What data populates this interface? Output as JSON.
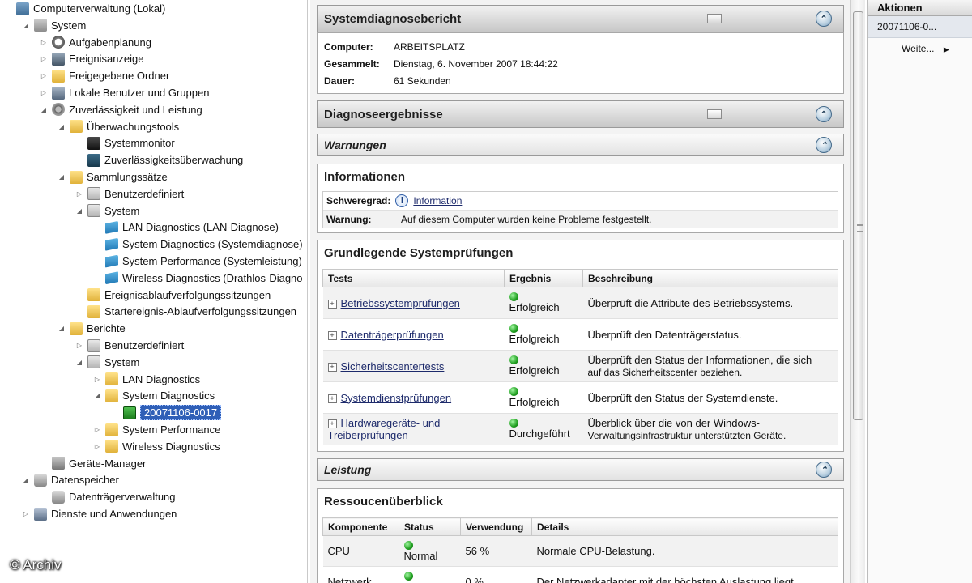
{
  "tree": {
    "nodes": [
      {
        "label": "Computerverwaltung (Lokal)",
        "icon": "computer-icon",
        "level": 0,
        "expander": "none"
      },
      {
        "label": "System",
        "icon": "system-tools-icon",
        "level": 1,
        "expander": "open"
      },
      {
        "label": "Aufgabenplanung",
        "icon": "clock-icon",
        "level": 2,
        "expander": "closed"
      },
      {
        "label": "Ereignisanzeige",
        "icon": "event-viewer-icon",
        "level": 2,
        "expander": "closed"
      },
      {
        "label": "Freigegebene Ordner",
        "icon": "shared-folder-icon",
        "level": 2,
        "expander": "closed"
      },
      {
        "label": "Lokale Benutzer und Gruppen",
        "icon": "users-icon",
        "level": 2,
        "expander": "closed"
      },
      {
        "label": "Zuverlässigkeit und Leistung",
        "icon": "performance-gear-icon",
        "level": 2,
        "expander": "open"
      },
      {
        "label": "Überwachungstools",
        "icon": "folder-icon",
        "level": 3,
        "expander": "open"
      },
      {
        "label": "Systemmonitor",
        "icon": "monitor-icon",
        "level": 4,
        "expander": "none"
      },
      {
        "label": "Zuverlässigkeitsüberwachung",
        "icon": "reliability-monitor-icon",
        "level": 4,
        "expander": "none"
      },
      {
        "label": "Sammlungssätze",
        "icon": "folder-icon",
        "level": 3,
        "expander": "open"
      },
      {
        "label": "Benutzerdefiniert",
        "icon": "report-icon",
        "level": 4,
        "expander": "closed"
      },
      {
        "label": "System",
        "icon": "report-icon",
        "level": 4,
        "expander": "open"
      },
      {
        "label": "LAN Diagnostics (LAN-Diagnose)",
        "icon": "collector-icon",
        "level": 5,
        "expander": "none"
      },
      {
        "label": "System Diagnostics (Systemdiagnose)",
        "icon": "collector-icon",
        "level": 5,
        "expander": "none"
      },
      {
        "label": "System Performance (Systemleistung)",
        "icon": "collector-icon",
        "level": 5,
        "expander": "none"
      },
      {
        "label": "Wireless Diagnostics (Drathlos-Diagno",
        "icon": "collector-icon",
        "level": 5,
        "expander": "none"
      },
      {
        "label": "Ereignisablaufverfolgungssitzungen",
        "icon": "folder-icon",
        "level": 4,
        "expander": "none"
      },
      {
        "label": "Startereignis-Ablaufverfolgungssitzungen",
        "icon": "folder-icon",
        "level": 4,
        "expander": "none"
      },
      {
        "label": "Berichte",
        "icon": "folder-icon",
        "level": 3,
        "expander": "open"
      },
      {
        "label": "Benutzerdefiniert",
        "icon": "report-icon",
        "level": 4,
        "expander": "closed"
      },
      {
        "label": "System",
        "icon": "report-icon",
        "level": 4,
        "expander": "open"
      },
      {
        "label": "LAN Diagnostics",
        "icon": "folder-icon",
        "level": 5,
        "expander": "closed"
      },
      {
        "label": "System Diagnostics",
        "icon": "folder-icon",
        "level": 5,
        "expander": "open"
      },
      {
        "label": "20071106-0017",
        "icon": "green-report-icon",
        "level": 6,
        "expander": "none",
        "selected": true
      },
      {
        "label": "System Performance",
        "icon": "folder-icon",
        "level": 5,
        "expander": "closed"
      },
      {
        "label": "Wireless Diagnostics",
        "icon": "folder-icon",
        "level": 5,
        "expander": "closed"
      },
      {
        "label": "Geräte-Manager",
        "icon": "device-manager-icon",
        "level": 2,
        "expander": "none"
      },
      {
        "label": "Datenspeicher",
        "icon": "storage-icon",
        "level": 1,
        "expander": "open"
      },
      {
        "label": "Datenträgerverwaltung",
        "icon": "disk-icon",
        "level": 2,
        "expander": "none"
      },
      {
        "label": "Dienste und Anwendungen",
        "icon": "services-icon",
        "level": 1,
        "expander": "closed"
      }
    ]
  },
  "watermark": "© Archiv",
  "report": {
    "header": "Systemdiagnosebericht",
    "computer_label": "Computer:",
    "computer_value": "ARBEITSPLATZ",
    "collected_label": "Gesammelt:",
    "collected_value": "Dienstag, 6. November 2007 18:44:22",
    "duration_label": "Dauer:",
    "duration_value": "61 Sekunden",
    "results_header": "Diagnoseergebnisse",
    "warnings_header": "Warnungen",
    "info": {
      "title": "Informationen",
      "severity_label": "Schweregrad:",
      "severity_value": "Information",
      "warning_label": "Warnung:",
      "warning_value": "Auf diesem Computer wurden keine Probleme festgestellt."
    },
    "basic": {
      "title": "Grundlegende Systemprüfungen",
      "columns": [
        "Tests",
        "Ergebnis",
        "Beschreibung"
      ],
      "rows": [
        {
          "test": "Betriebssystemprüfungen",
          "test2": "",
          "result": "Erfolgreich",
          "desc": "Überprüft die Attribute des Betriebssystems.",
          "desc2": ""
        },
        {
          "test": "Datenträgerprüfungen",
          "test2": "",
          "result": "Erfolgreich",
          "desc": "Überprüft den Datenträgerstatus.",
          "desc2": ""
        },
        {
          "test": "Sicherheitscentertests",
          "test2": "",
          "result": "Erfolgreich",
          "desc": "Überprüft den Status der Informationen, die sich",
          "desc2": "auf das Sicherheitscenter beziehen."
        },
        {
          "test": "Systemdienstprüfungen",
          "test2": "",
          "result": "Erfolgreich",
          "desc": "Überprüft den Status der Systemdienste.",
          "desc2": ""
        },
        {
          "test": "Hardwaregeräte- und",
          "test2": "Treiberprüfungen",
          "result": "Durchgeführt",
          "desc": "Überblick über die von der Windows-",
          "desc2": "Verwaltungsinfrastruktur unterstützten Geräte."
        }
      ]
    },
    "performance_header": "Leistung",
    "resources": {
      "title": "Ressoucenüberblick",
      "columns": [
        "Komponente",
        "Status",
        "Verwendung",
        "Details"
      ],
      "rows": [
        {
          "component": "CPU",
          "status": "Normal",
          "usage": "56 %",
          "details": "Normale CPU-Belastung."
        },
        {
          "component": "Netzwerk",
          "status": "Im",
          "usage": "0 %",
          "details": "Der Netzwerkadapter mit der höchsten Auslastung liegt"
        }
      ]
    }
  },
  "actions": {
    "title": "Aktionen",
    "item": "20071106-0...",
    "more": "Weite..."
  }
}
